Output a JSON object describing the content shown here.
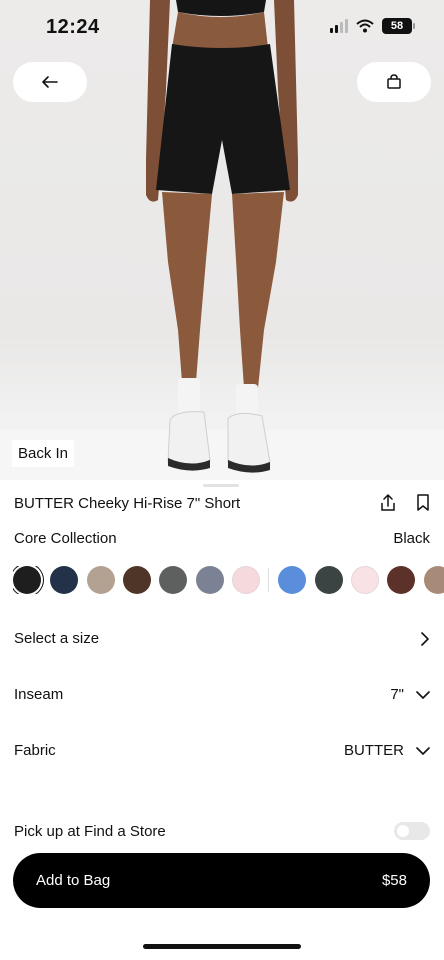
{
  "status_bar": {
    "time": "12:24",
    "battery": "58"
  },
  "hero": {
    "badge": "Back In"
  },
  "product": {
    "title": "BUTTER Cheeky Hi-Rise 7\" Short",
    "collection": "Core Collection",
    "color_name": "Black"
  },
  "swatches": [
    {
      "color": "#1e1e1e",
      "selected": true
    },
    {
      "color": "#233248",
      "selected": false
    },
    {
      "color": "#b3a292",
      "selected": false
    },
    {
      "color": "#4f3428",
      "selected": false
    },
    {
      "color": "#5e5f5f",
      "selected": false
    },
    {
      "color": "#7a8293",
      "selected": false
    },
    {
      "color": "#f5d9dc",
      "selected": false
    },
    {
      "color": "#5a8ddb",
      "selected": false
    },
    {
      "color": "#3b4443",
      "selected": false
    },
    {
      "color": "#f9e2e5",
      "selected": false
    },
    {
      "color": "#5b3129",
      "selected": false
    },
    {
      "color": "#a88a78",
      "selected": false
    }
  ],
  "options": {
    "size_label": "Select a size",
    "inseam_label": "Inseam",
    "inseam_value": "7\"",
    "fabric_label": "Fabric",
    "fabric_value": "BUTTER",
    "pickup_label": "Pick up at Find a Store"
  },
  "cart": {
    "label": "Add to Bag",
    "price": "$58"
  }
}
